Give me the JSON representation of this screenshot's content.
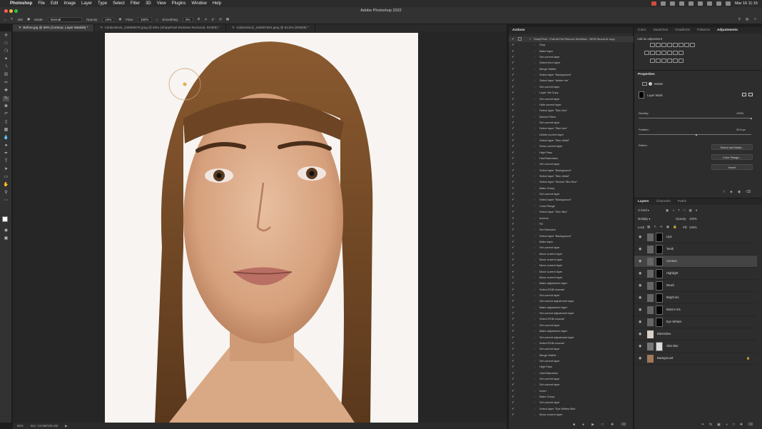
{
  "menubar": {
    "apple": "",
    "app": "Photoshop",
    "items": [
      "File",
      "Edit",
      "Image",
      "Layer",
      "Type",
      "Select",
      "Filter",
      "3D",
      "View",
      "Plugins",
      "Window",
      "Help"
    ],
    "clock": "Mar 16  11:15"
  },
  "titlebar": {
    "title": "Adobe Photoshop 2022"
  },
  "options": {
    "brush_size": "250",
    "mode_label": "Mode:",
    "mode_value": "Normal",
    "opacity_label": "Opacity:",
    "opacity_value": "10%",
    "flow_label": "Flow:",
    "flow_value": "100%",
    "smoothing_label": "Smoothing:",
    "smoothing_value": "0%",
    "angle": "0°"
  },
  "doc_tabs": [
    "Before.jpg @ 50% (Contour, Layer Mask/8) *",
    "AdobeStock_245965075.jpeg @ 50% (SharpPixel Redness Removal, RGB/8) *",
    "AdobeStock_165867652.jpeg @ 53.5% (RGB/8) *"
  ],
  "status": {
    "zoom": "50%",
    "doc": "Doc: 22.9M/106.4M"
  },
  "actions": {
    "tabs": [
      "Actions"
    ],
    "set_name": "SharpPixel - Portrait Full Retouch Workflow - NEW Neural AI copy",
    "items": [
      "Stop",
      "Make layer",
      "Set current layer",
      "Select front layer",
      "Merge Visible",
      "Select layer \"Background\"",
      "Select layer \"delete me\"",
      "Set current layer",
      "Layer Via Copy",
      "Set current layer",
      "Hide current layer",
      "Select layer \"Skin blur\"",
      "Neural Filters",
      "Set current layer",
      "Select layer \"Skin blur\"",
      "Delete current layer",
      "Select layer \"Skin detail\"",
      "Show current layer",
      "High Pass",
      "Hue/Saturation",
      "Set current layer",
      "Select layer \"Background\"",
      "Select layer \"Skin detail\"",
      "Select layer \"Neural Filter Blur\"",
      "Make Group",
      "Set current layer",
      "Select layer \"Background\"",
      "Color Range",
      "Select layer \"Skin Blur\"",
      "Inverse",
      "Fill",
      "Set Selection",
      "Select layer \"Background\"",
      "Make layer",
      "Set current layer",
      "Move current layer",
      "Move current layer",
      "Move current layer",
      "Move current layer",
      "Move current layer",
      "Make adjustment layer",
      "Select RGB channel",
      "Set current layer",
      "Set current adjustment layer",
      "Make adjustment layer",
      "Set current adjustment layer",
      "Select RGB channel",
      "Set current layer",
      "Make adjustment layer",
      "Set current adjustment layer",
      "Select RGB channel",
      "Set current layer",
      "Merge Visible",
      "Set current layer",
      "High Pass",
      "Hue/Saturation",
      "Set current layer",
      "Set current layer",
      "Invert",
      "Make Group",
      "Set current layer",
      "Select layer \"Eye Whites Blur\"",
      "Move current layer"
    ]
  },
  "right_tabs": {
    "top": [
      "Color",
      "Swatches",
      "Gradients",
      "Patterns",
      "Adjustments"
    ],
    "add_adjustment": "Add an adjustment"
  },
  "properties": {
    "title": "Properties",
    "masks_label": "Masks",
    "layer_mask_label": "Layer Mask",
    "density_label": "Density:",
    "density_value": "100%",
    "feather_label": "Feather:",
    "feather_value": "39.8 px",
    "refine_label": "Refine:",
    "select_mask": "Select and Mask...",
    "color_range": "Color Range...",
    "invert": "Invert"
  },
  "layers": {
    "tabs": [
      "Layers",
      "Channels",
      "Paths"
    ],
    "kind": "Kind",
    "blend": "Multiply",
    "opacity_label": "Opacity:",
    "opacity_value": "100%",
    "lock_label": "Lock:",
    "fill_label": "Fill:",
    "fill_value": "100%",
    "rows": [
      "Lips",
      "Teeth",
      "Contour",
      "Highlight",
      "Brush",
      "Bright iris",
      "BluGrn iris",
      "Eye Whites",
      "Blemishes",
      "Skin Blur",
      "Background"
    ]
  }
}
